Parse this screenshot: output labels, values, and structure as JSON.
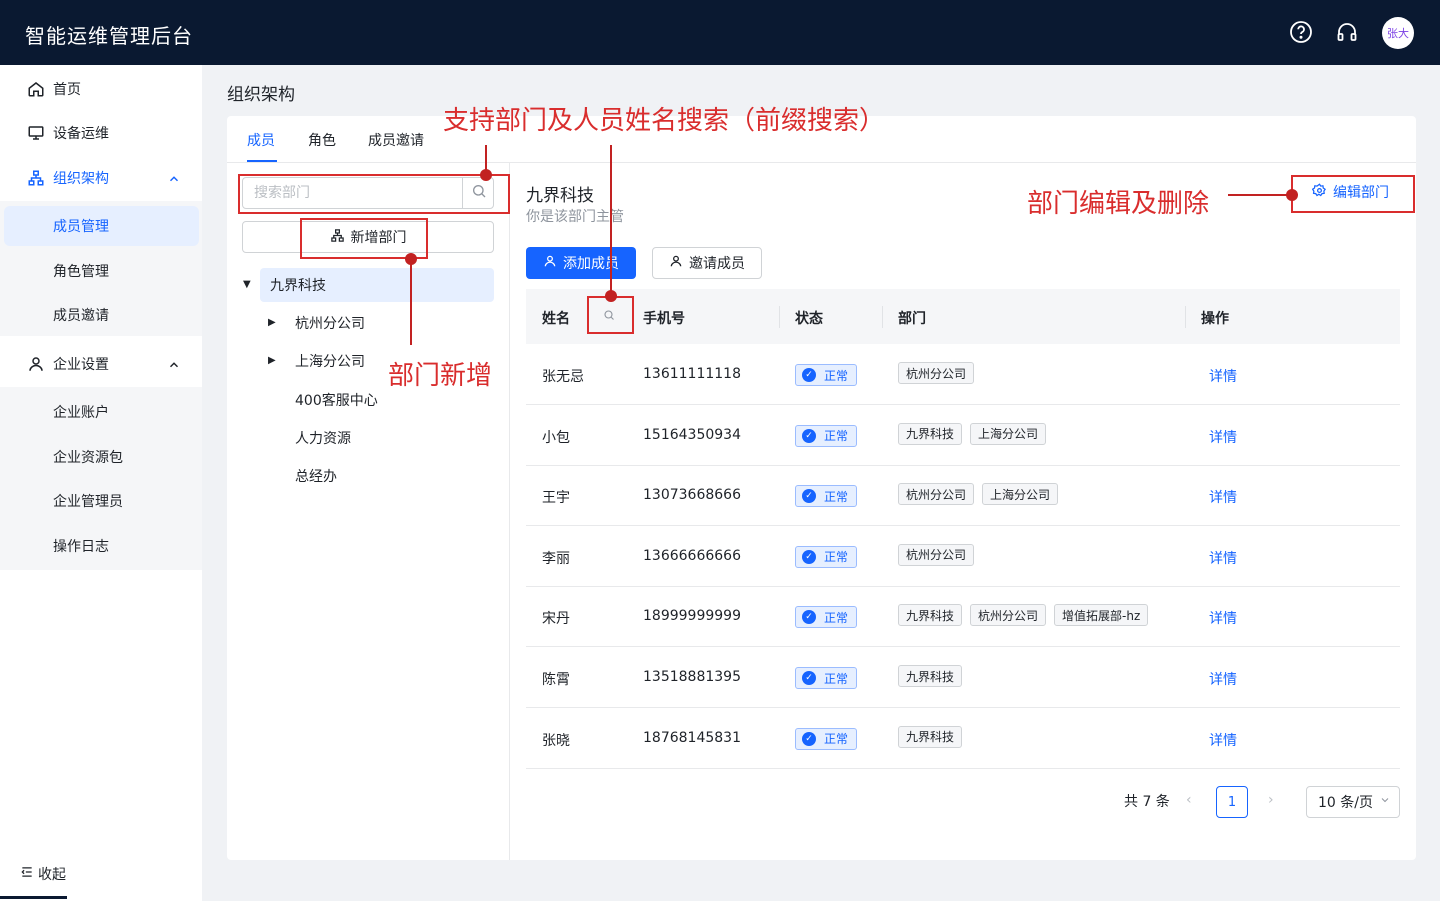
{
  "header": {
    "app_title": "智能运维管理后台",
    "avatar_text": "张大",
    "icons": [
      "help-icon",
      "headset-icon"
    ]
  },
  "sidebar": {
    "items": [
      {
        "label": "首页",
        "icon": "home-icon"
      },
      {
        "label": "设备运维",
        "icon": "monitor-icon"
      },
      {
        "label": "组织架构",
        "icon": "org-chart-icon"
      },
      {
        "label": "成员管理"
      },
      {
        "label": "角色管理"
      },
      {
        "label": "成员邀请"
      },
      {
        "label": "企业设置",
        "icon": "user-icon"
      },
      {
        "label": "企业账户"
      },
      {
        "label": "企业资源包"
      },
      {
        "label": "企业管理员"
      },
      {
        "label": "操作日志"
      }
    ],
    "collapse_label": "收起"
  },
  "page": {
    "title": "组织架构",
    "tabs": [
      "成员",
      "角色",
      "成员邀请"
    ]
  },
  "tree": {
    "search_placeholder": "搜索部门",
    "add_dept_label": "新增部门",
    "nodes": [
      "九界科技",
      "杭州分公司",
      "上海分公司",
      "400客服中心",
      "人力资源",
      "总经办"
    ]
  },
  "dept": {
    "name": "九界科技",
    "subtitle": "你是该部门主管",
    "edit_label": "编辑部门",
    "add_member_label": "添加成员",
    "invite_member_label": "邀请成员"
  },
  "table": {
    "headers": [
      "姓名",
      "手机号",
      "状态",
      "部门",
      "操作"
    ],
    "rows": [
      {
        "name": "张无忌",
        "phone": "13611111118",
        "status": "正常",
        "depts": [
          "杭州分公司"
        ],
        "action": "详情"
      },
      {
        "name": "小包",
        "phone": "15164350934",
        "status": "正常",
        "depts": [
          "九界科技",
          "上海分公司"
        ],
        "action": "详情"
      },
      {
        "name": "王宇",
        "phone": "13073668666",
        "status": "正常",
        "depts": [
          "杭州分公司",
          "上海分公司"
        ],
        "action": "详情"
      },
      {
        "name": "李丽",
        "phone": "13666666666",
        "status": "正常",
        "depts": [
          "杭州分公司"
        ],
        "action": "详情"
      },
      {
        "name": "宋丹",
        "phone": "18999999999",
        "status": "正常",
        "depts": [
          "九界科技",
          "杭州分公司",
          "增值拓展部-hz"
        ],
        "action": "详情"
      },
      {
        "name": "陈霄",
        "phone": "13518881395",
        "status": "正常",
        "depts": [
          "九界科技"
        ],
        "action": "详情"
      },
      {
        "name": "张晓",
        "phone": "18768145831",
        "status": "正常",
        "depts": [
          "九界科技"
        ],
        "action": "详情"
      }
    ]
  },
  "pagination": {
    "total": "共 7 条",
    "current_page": "1",
    "page_size": "10 条/页"
  },
  "annotations": {
    "search_note": "支持部门及人员姓名搜索（前缀搜索）",
    "add_note": "部门新增",
    "edit_note": "部门编辑及删除"
  },
  "colors": {
    "header_bg": "#0a1931",
    "accent": "#1664ff",
    "annotation": "#d92d2d"
  }
}
